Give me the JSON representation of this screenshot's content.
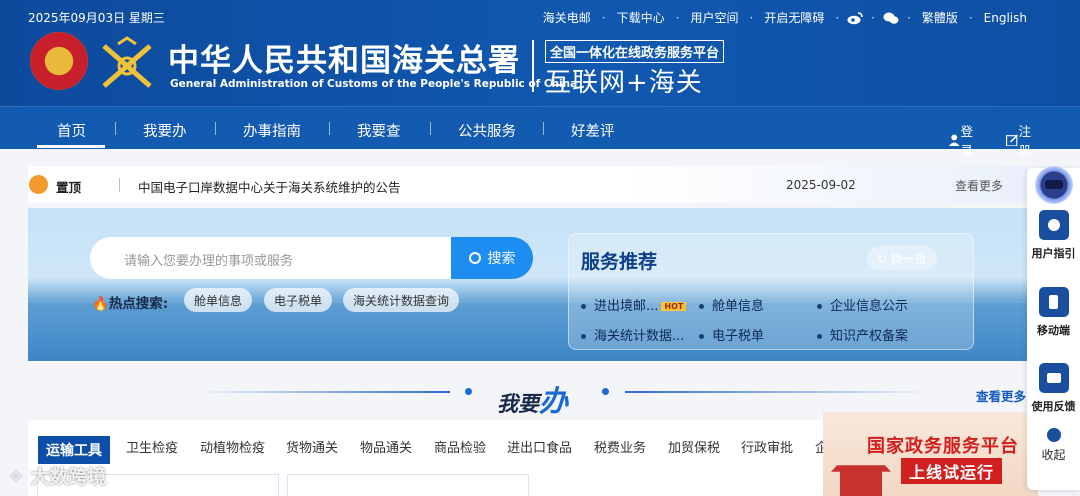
{
  "header": {
    "date": "2025年09月03日 星期三",
    "links": [
      "海关电邮",
      "下载中心",
      "用户空间",
      "开启无障碍"
    ],
    "lang_links": [
      "繁體版",
      "English"
    ],
    "title": "中华人民共和国海关总署",
    "subtitle": "General Administration of Customs of the People's Republic of China",
    "platform_small": "全国一体化在线政务服务平台",
    "platform_big": "互联网+海关"
  },
  "nav": {
    "items": [
      "首页",
      "我要办",
      "办事指南",
      "我要查",
      "公共服务",
      "好差评"
    ],
    "login": "登录",
    "register": "注册"
  },
  "notice": {
    "label": "置顶",
    "text": "中国电子口岸数据中心关于海关系统维护的公告",
    "date": "2025-09-02",
    "more": "查看更多"
  },
  "search": {
    "placeholder": "请输入您要办理的事项或服务",
    "button": "搜索",
    "hot_label": "热点搜索:",
    "hot_items": [
      "舱单信息",
      "电子税单",
      "海关统计数据查询"
    ]
  },
  "services": {
    "title": "服务推荐",
    "refresh": "换一批",
    "items": [
      "进出境邮...",
      "舱单信息",
      "企业信息公示",
      "海关统计数据...",
      "电子税单",
      "知识产权备案"
    ],
    "hot_badge": "HOT"
  },
  "section": {
    "title_small": "我要",
    "title_big": "办",
    "more": "查看更多"
  },
  "tabs": [
    "运输工具",
    "卫生检疫",
    "动植物检疫",
    "货物通关",
    "物品通关",
    "商品检验",
    "进出口食品",
    "税费业务",
    "加贸保税",
    "行政审批",
    "企"
  ],
  "promo": {
    "line1": "国家政务服务平台",
    "line2": "上线试运行"
  },
  "float_bar": {
    "items": [
      "用户指引",
      "移动端",
      "使用反馈"
    ],
    "collapse": "收起"
  },
  "watermark": "大数跨境",
  "colors": {
    "primary": "#135ab1",
    "accent": "#1e8df2",
    "hot": "#f6c23b"
  }
}
